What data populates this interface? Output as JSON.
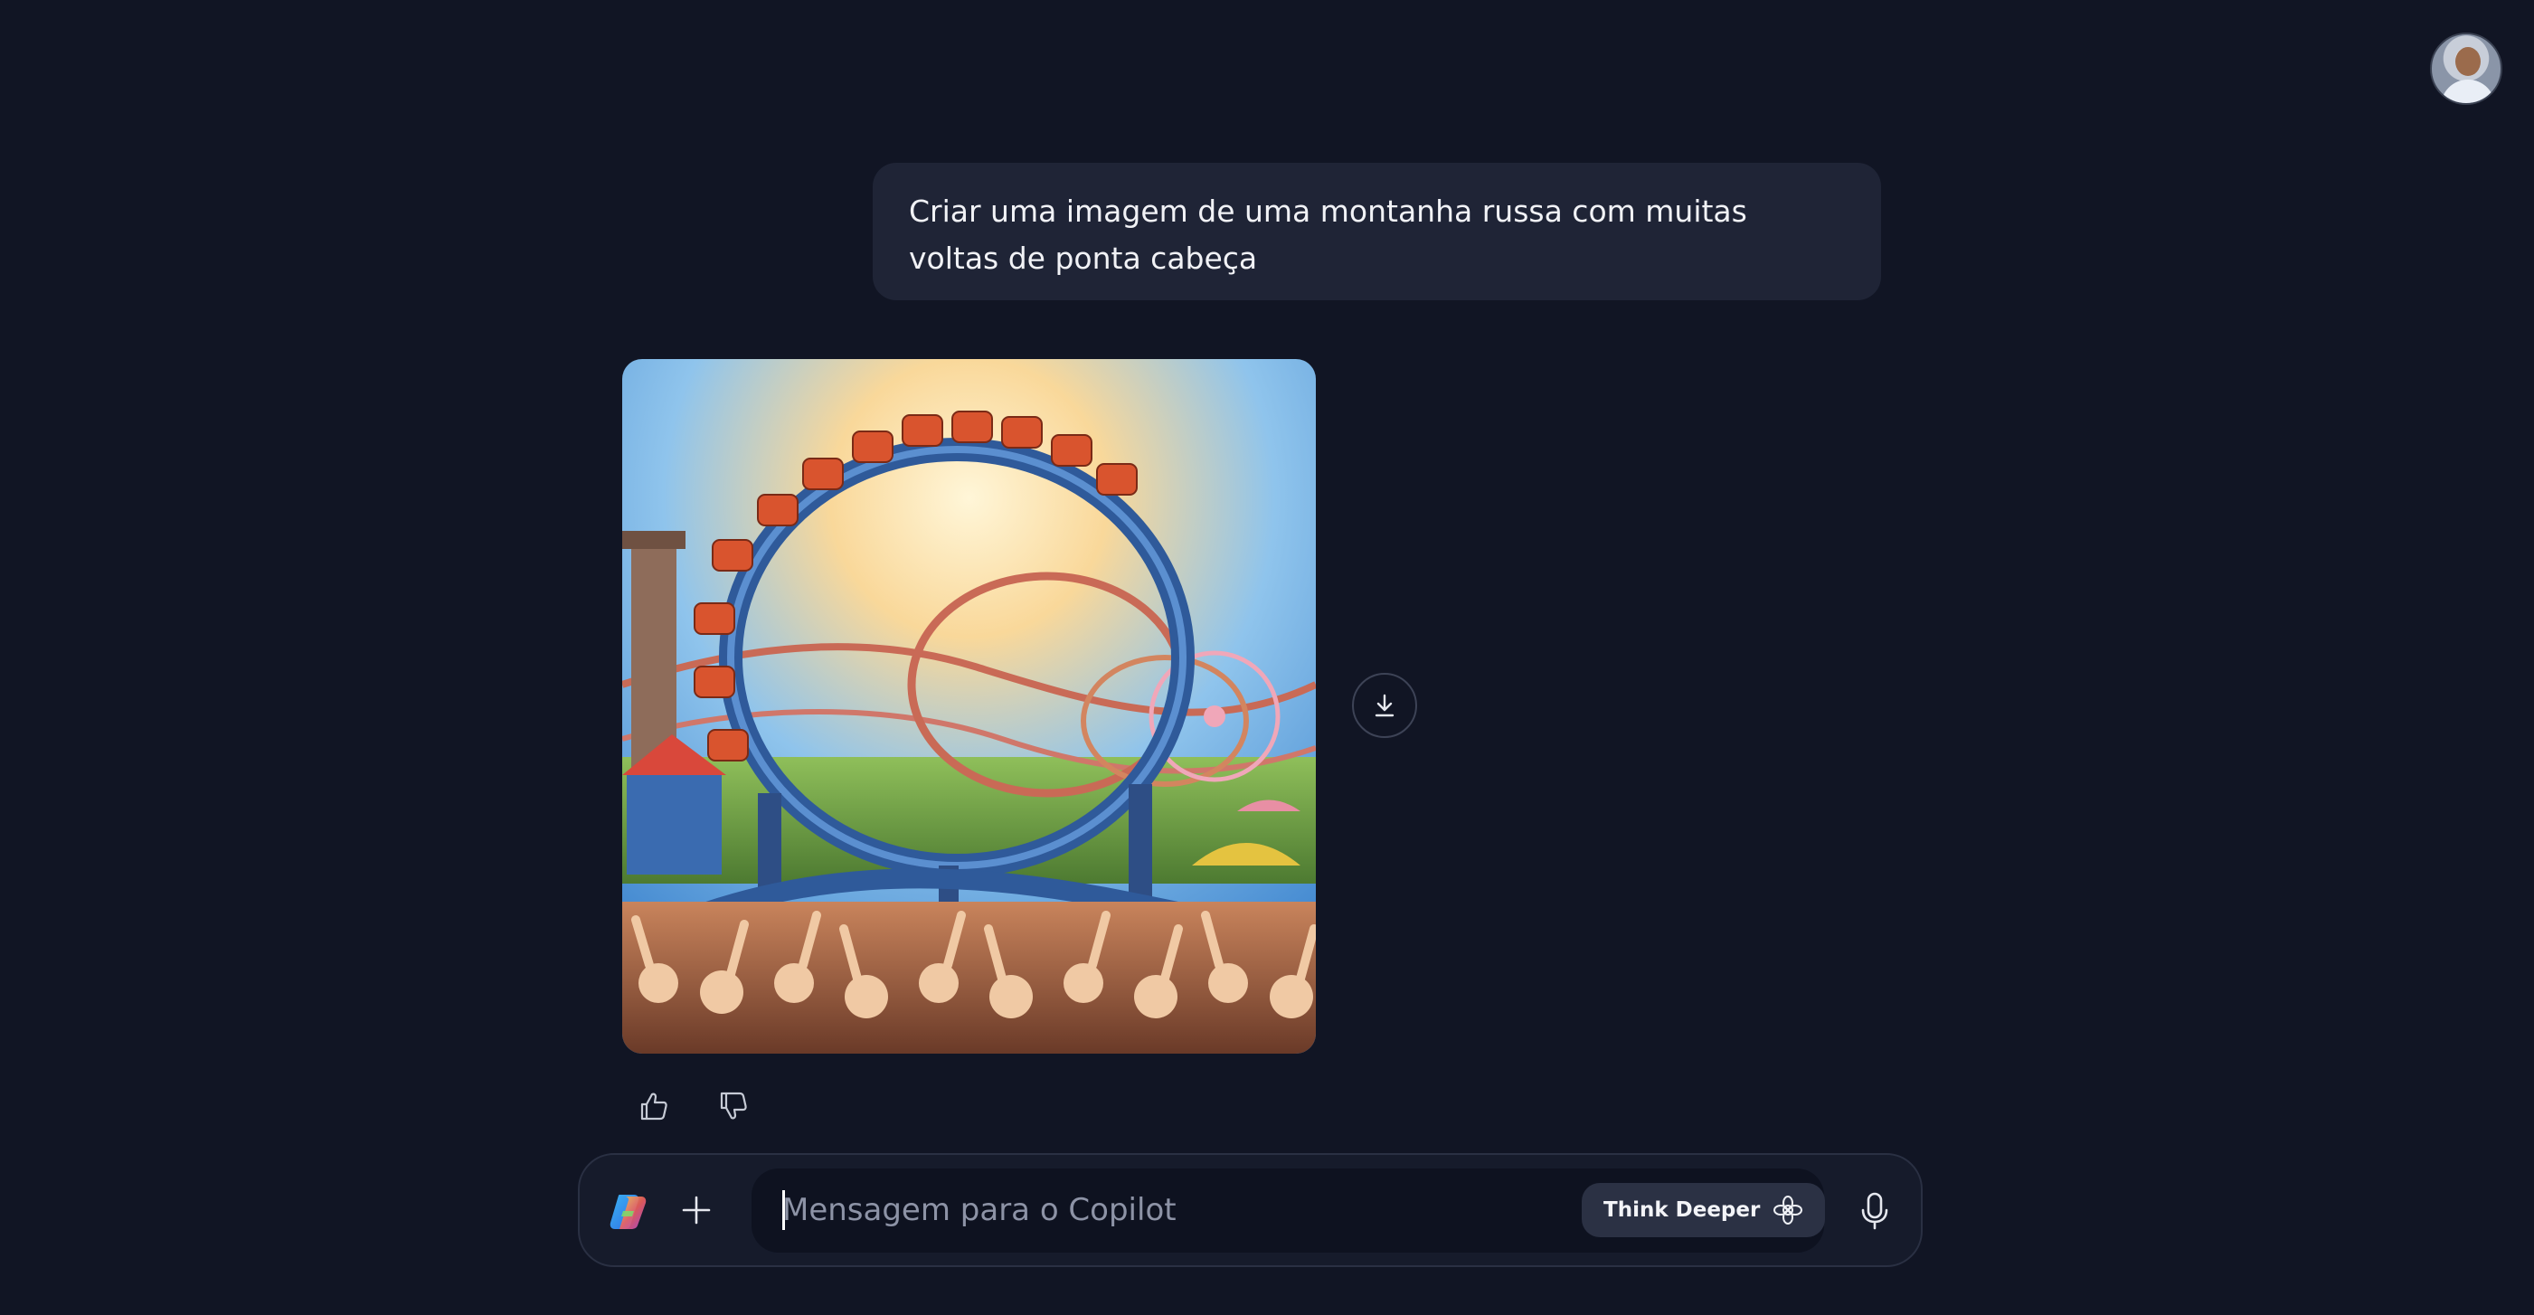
{
  "user": {
    "avatar_icon": "user-avatar"
  },
  "conversation": {
    "user_message": "Criar uma imagem de uma montanha russa com muitas voltas de ponta cabeça",
    "response": {
      "image_subject": "roller-coaster-loop-image",
      "download_icon": "download-icon",
      "feedback": {
        "like_icon": "thumbs-up-icon",
        "dislike_icon": "thumbs-down-icon"
      }
    }
  },
  "composer": {
    "logo_icon": "copilot-logo-icon",
    "add_icon": "plus-icon",
    "placeholder": "Mensagem para o Copilot",
    "value": "",
    "think_deeper_label": "Think Deeper",
    "think_deeper_icon": "think-deeper-icon",
    "mic_icon": "microphone-icon"
  },
  "colors": {
    "background": "#111524",
    "bubble": "#1f2436",
    "composer": "#161b2b",
    "input": "#0e1220",
    "chip": "#2b3144"
  }
}
